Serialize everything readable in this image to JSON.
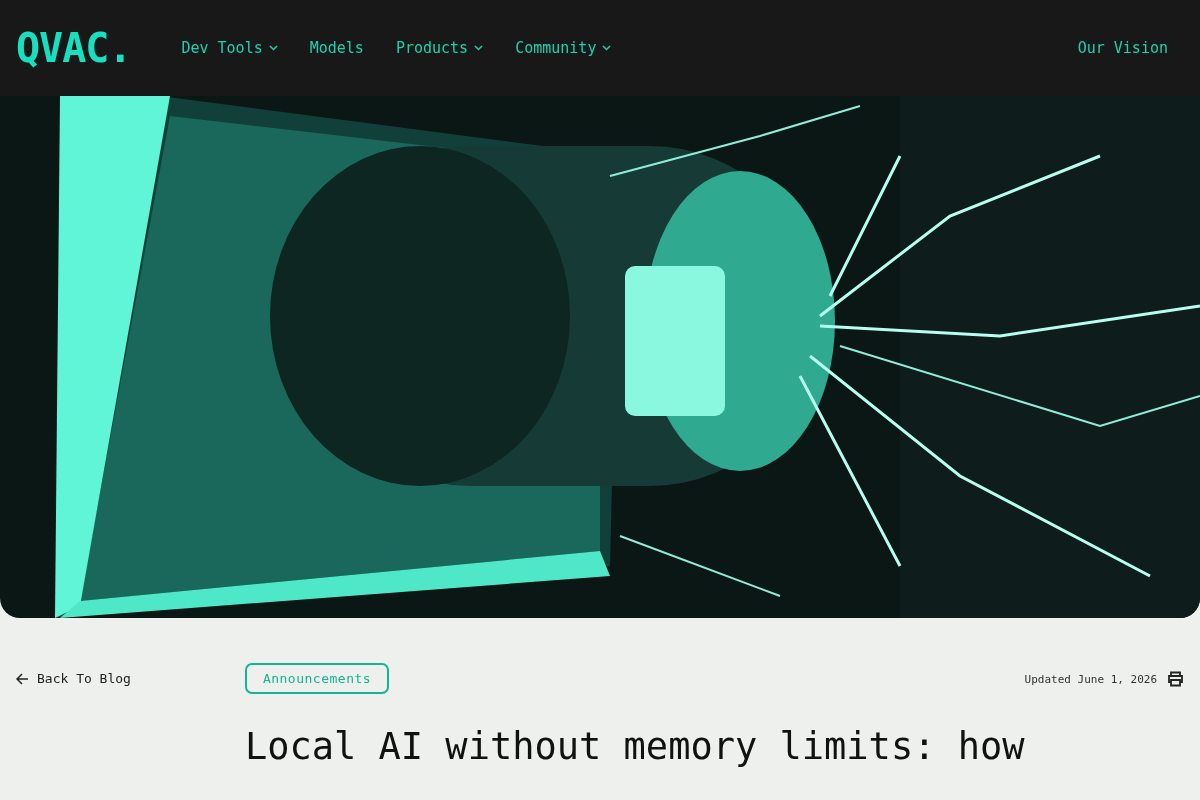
{
  "header": {
    "logo": "QVAC.",
    "nav": [
      {
        "label": "Dev Tools",
        "dropdown": true
      },
      {
        "label": "Models",
        "dropdown": false
      },
      {
        "label": "Products",
        "dropdown": true
      },
      {
        "label": "Community",
        "dropdown": true
      }
    ],
    "right_link": "Our Vision"
  },
  "article": {
    "back_link": "Back To Blog",
    "tag": "Announcements",
    "updated": "Updated June 1, 2026",
    "title": "Local AI without memory limits: how"
  }
}
